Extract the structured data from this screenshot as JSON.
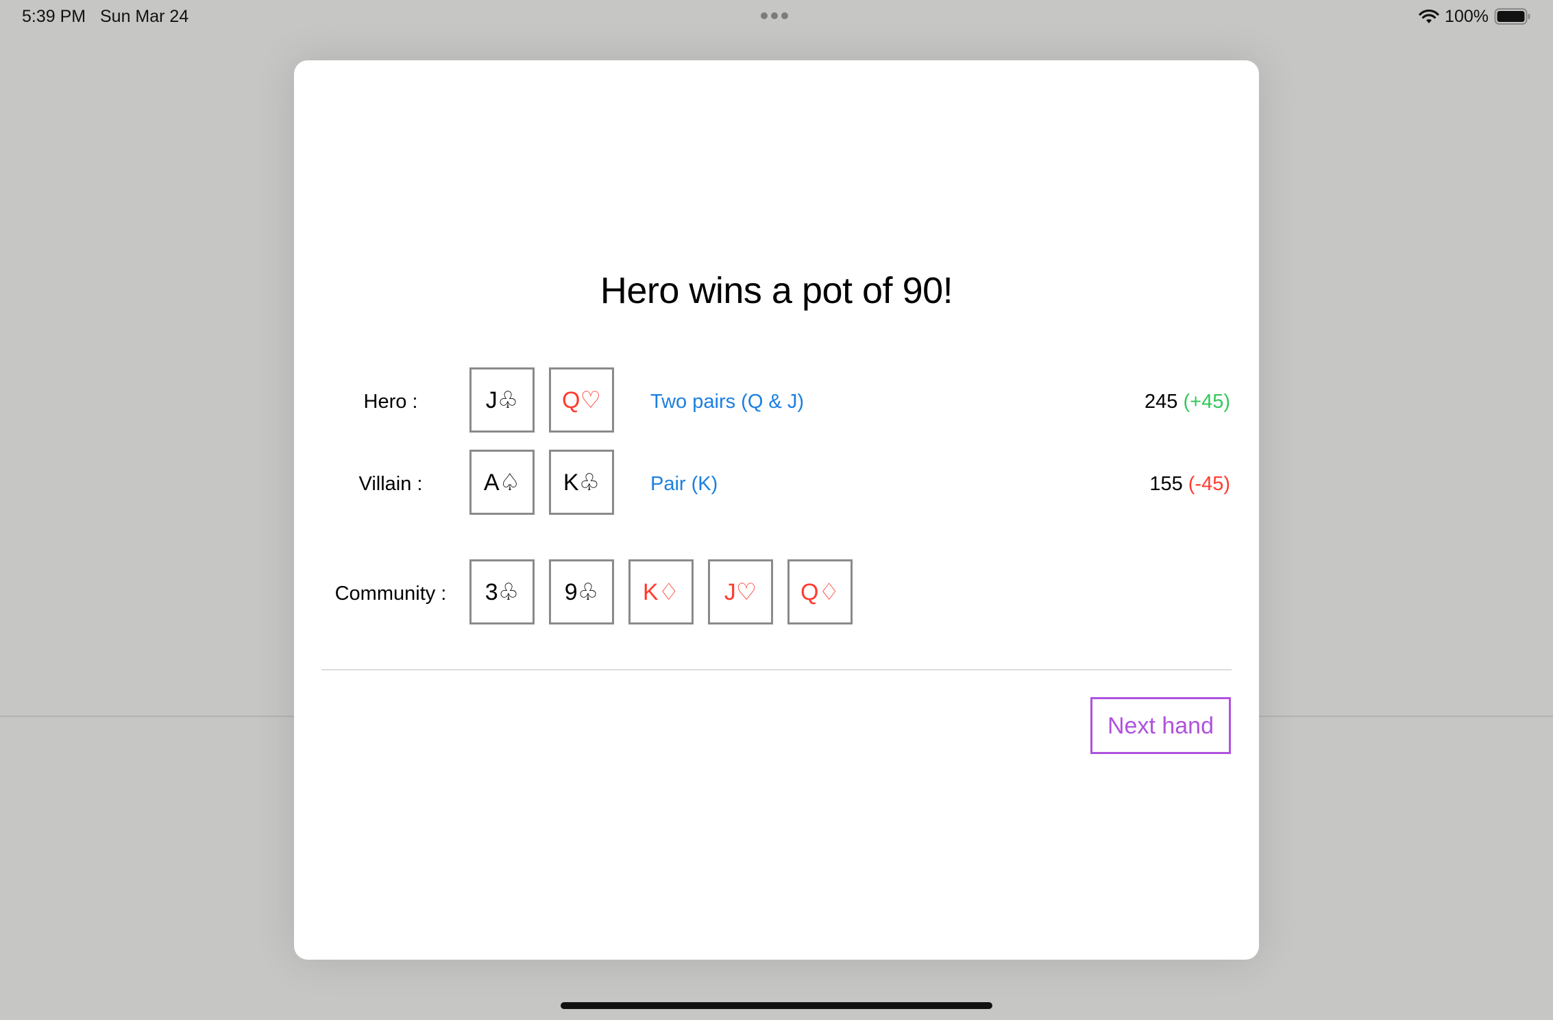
{
  "status_bar": {
    "time": "5:39 PM",
    "date": "Sun Mar 24",
    "battery_percent": "100%",
    "icons": [
      "multitask-dots-icon",
      "wifi-icon",
      "battery-icon"
    ]
  },
  "result": {
    "title": "Hero wins a pot of 90!"
  },
  "hero": {
    "label": "Hero :",
    "cards": [
      {
        "text": "J♧",
        "color": "black"
      },
      {
        "text": "Q♡",
        "color": "red"
      }
    ],
    "hand": "Two pairs (Q & J)",
    "stack": "245",
    "delta": "(+45)"
  },
  "villain": {
    "label": "Villain :",
    "cards": [
      {
        "text": "A♤",
        "color": "black"
      },
      {
        "text": "K♧",
        "color": "black"
      }
    ],
    "hand": "Pair (K)",
    "stack": "155",
    "delta": "(-45)"
  },
  "community": {
    "label": "Community :",
    "cards": [
      {
        "text": "3♧",
        "color": "black"
      },
      {
        "text": "9♧",
        "color": "black"
      },
      {
        "text": "K♢",
        "color": "red"
      },
      {
        "text": "J♡",
        "color": "red"
      },
      {
        "text": "Q♢",
        "color": "red"
      }
    ]
  },
  "actions": {
    "next_hand": "Next hand"
  },
  "colors": {
    "hand_name": "#1a7fe0",
    "gain": "#34c759",
    "loss": "#ff3b30",
    "red_suit": "#ff3b30",
    "button_accent": "#af52de",
    "card_border": "#8a8a8a",
    "backdrop": "#c6c7c5"
  }
}
